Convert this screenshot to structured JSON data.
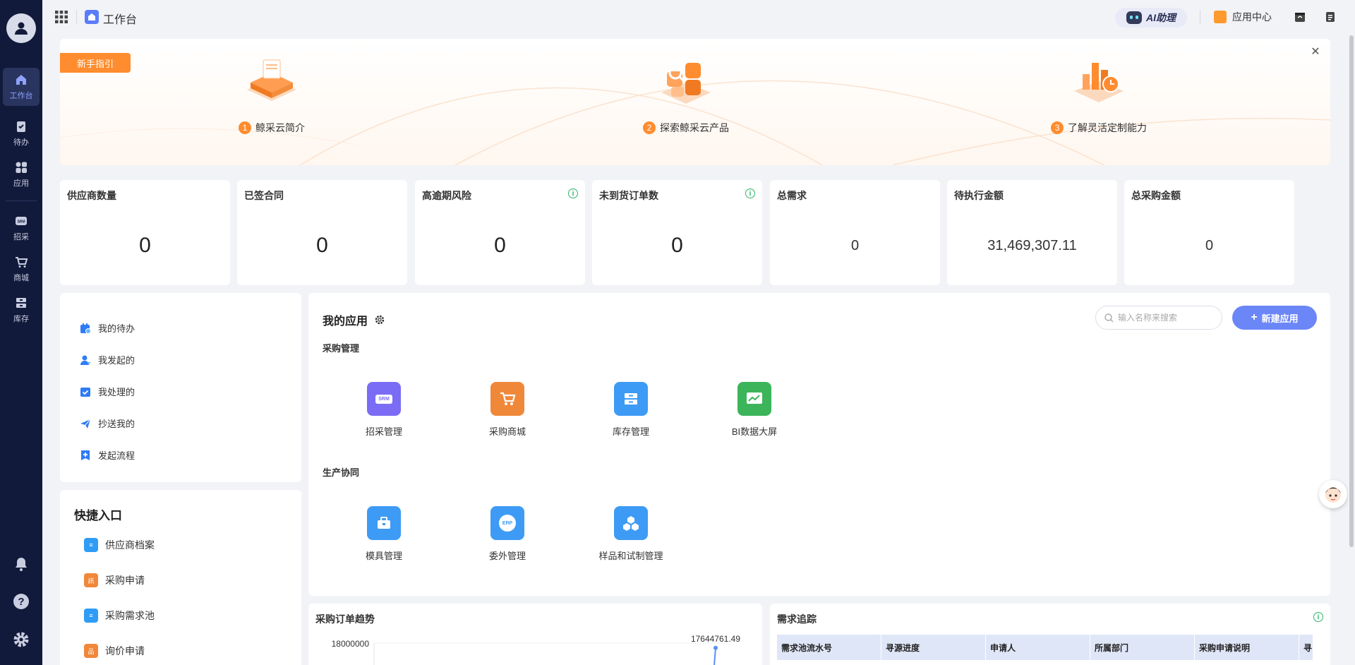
{
  "rail": {
    "items": [
      {
        "label": "工作台",
        "icon": "home-icon"
      },
      {
        "label": "待办",
        "icon": "clipboard-icon"
      },
      {
        "label": "应用",
        "icon": "apps-icon"
      },
      {
        "label": "招采",
        "icon": "srm-icon"
      },
      {
        "label": "商城",
        "icon": "cart-icon"
      },
      {
        "label": "库存",
        "icon": "inventory-icon"
      }
    ]
  },
  "topbar": {
    "title": "工作台",
    "ai_label": "AI助理",
    "app_center": "应用中心"
  },
  "banner": {
    "tag": "新手指引",
    "steps": [
      {
        "num": "1",
        "label": "鲸采云简介"
      },
      {
        "num": "2",
        "label": "探索鲸采云产品"
      },
      {
        "num": "3",
        "label": "了解灵活定制能力"
      }
    ]
  },
  "stats": [
    {
      "label": "供应商数量",
      "value": "0"
    },
    {
      "label": "已签合同",
      "value": "0"
    },
    {
      "label": "高逾期风险",
      "value": "0"
    },
    {
      "label": "未到货订单数",
      "value": "0"
    },
    {
      "label": "总需求",
      "value": "0"
    },
    {
      "label": "待执行金额",
      "value": "31,469,307.11"
    },
    {
      "label": "总采购金额",
      "value": "0"
    }
  ],
  "todo": [
    {
      "label": "我的待办"
    },
    {
      "label": "我发起的"
    },
    {
      "label": "我处理的"
    },
    {
      "label": "抄送我的"
    },
    {
      "label": "发起流程"
    }
  ],
  "quick": {
    "title": "快捷入口",
    "items": [
      {
        "label": "供应商档案"
      },
      {
        "label": "采购申请"
      },
      {
        "label": "采购需求池"
      },
      {
        "label": "询价申请"
      }
    ]
  },
  "apps": {
    "title": "我的应用",
    "search_placeholder": "输入名称来搜索",
    "new_label": "新建应用",
    "groups": [
      {
        "title": "采购管理",
        "items": [
          {
            "label": "招采管理",
            "tile_text": "SRM",
            "color": "#7b6cf6"
          },
          {
            "label": "采购商城",
            "tile_text": "",
            "color": "#f0883a"
          },
          {
            "label": "库存管理",
            "tile_text": "",
            "color": "#3d9bf5"
          },
          {
            "label": "BI数据大屏",
            "tile_text": "",
            "color": "#3cb55a"
          }
        ]
      },
      {
        "title": "生产协同",
        "items": [
          {
            "label": "模具管理",
            "tile_text": "",
            "color": "#3d9bf5"
          },
          {
            "label": "委外管理",
            "tile_text": "ERP",
            "color": "#3d9bf5"
          },
          {
            "label": "样品和试制管理",
            "tile_text": "",
            "color": "#3d9bf5"
          }
        ]
      }
    ]
  },
  "order_trend": {
    "title": "采购订单趋势"
  },
  "chart_data": {
    "type": "line",
    "title": "采购订单趋势",
    "y_tick_top": "18000000",
    "peak_label": "17644761.49",
    "peak_value": 17644761.49,
    "ylim": [
      0,
      18000000
    ]
  },
  "demand": {
    "title": "需求追踪",
    "columns": [
      "需求池流水号",
      "寻源进度",
      "申请人",
      "所属部门",
      "采购申请说明",
      "寻"
    ]
  }
}
